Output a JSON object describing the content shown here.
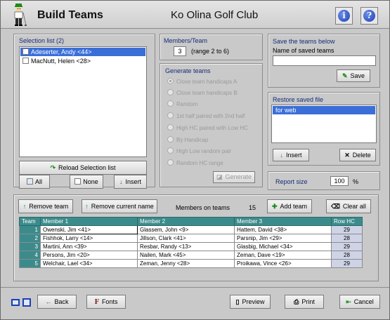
{
  "header": {
    "title": "Build Teams",
    "club": "Ko Olina Golf Club"
  },
  "selection": {
    "title": "Selection list (2)",
    "items": [
      "Adeserter, Andy <44>",
      "MacNutt, Helen <28>"
    ],
    "reload_label": "Reload Selection list",
    "all_label": "All",
    "none_label": "None",
    "insert_label": "Insert"
  },
  "members_per_team": {
    "title": "Members/Team",
    "value": "3",
    "range": "(range 2 to 6)"
  },
  "generate": {
    "title": "Generate teams",
    "options": [
      "Close team handicaps A",
      "Close team handicaps B",
      "Random",
      "1st half paired with 2nd half",
      "High HC paired with Low HC",
      "By Handicap",
      "High Low random pair",
      "Random HC range"
    ],
    "button_label": "Generate"
  },
  "save": {
    "title": "Save the teams below",
    "name_label": "Name of saved teams",
    "name_value": "",
    "save_label": "Save"
  },
  "restore": {
    "title": "Restore saved file",
    "items": [
      "for web"
    ],
    "insert_label": "Insert",
    "delete_label": "Delete"
  },
  "report": {
    "label": "Report size",
    "value": "100",
    "unit": "%"
  },
  "teams_toolbar": {
    "remove_team_label": "Remove team",
    "remove_name_label": "Remove current name",
    "members_on_teams_label": "Members on teams",
    "members_on_teams_value": "15",
    "add_team_label": "Add team",
    "clear_all_label": "Clear all"
  },
  "teams_table": {
    "columns": [
      "Team",
      "Member 1",
      "Member 2",
      "Member 3",
      "Row HC"
    ],
    "rows": [
      {
        "team": "1",
        "m1": "Owenski, Jim <41>",
        "m2": "Glassem, John <9>",
        "m3": "Hattem, David <38>",
        "hc": "29"
      },
      {
        "team": "2",
        "m1": "Fishhok, Larry <14>",
        "m2": "Jillson, Clark <41>",
        "m3": "Parsnip, Jim <29>",
        "hc": "28"
      },
      {
        "team": "3",
        "m1": "Martini, Ann <39>",
        "m2": "Resbar, Randy <13>",
        "m3": "Glasbig, Michael <34>",
        "hc": "29"
      },
      {
        "team": "4",
        "m1": "Persons, Jim <20>",
        "m2": "Nailen, Mark <45>",
        "m3": "Zeman, Dave <19>",
        "hc": "28"
      },
      {
        "team": "5",
        "m1": "Welchair, Lael <34>",
        "m2": "Zeman, Jenny <28>",
        "m3": "Proikawa, Vince <26>",
        "hc": "29"
      }
    ]
  },
  "footer": {
    "back_label": "Back",
    "fonts_label": "Fonts",
    "preview_label": "Preview",
    "print_label": "Print",
    "cancel_label": "Cancel"
  }
}
